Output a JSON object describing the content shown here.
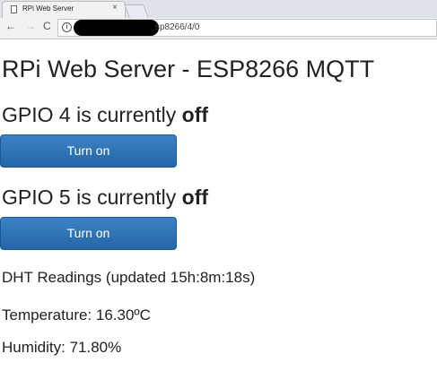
{
  "browser": {
    "tab_title": "RPi Web Server",
    "tab_close": "×",
    "url_visible": "sp8266/4/0",
    "nav_back": "←",
    "nav_forward": "→",
    "nav_reload": "C",
    "info_glyph": "i"
  },
  "page": {
    "title": "RPi Web Server - ESP8266 MQTT",
    "gpio4": {
      "prefix": "GPIO 4 is currently ",
      "state": "off",
      "button_label": "Turn on"
    },
    "gpio5": {
      "prefix": "GPIO 5 is currently ",
      "state": "off",
      "button_label": "Turn on"
    },
    "dht_heading": "DHT Readings (updated 15h:8m:18s)",
    "temperature": "Temperature: 16.30ºC",
    "humidity": "Humidity: 71.80%"
  },
  "colors": {
    "button_bg": "#2d6fb3",
    "button_text": "#ffffff",
    "text": "#222222"
  }
}
